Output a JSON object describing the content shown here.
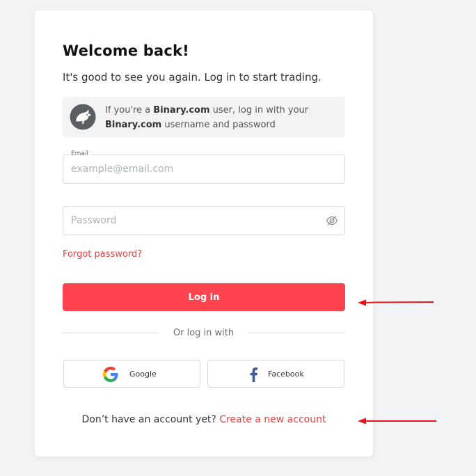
{
  "login": {
    "title": "Welcome back!",
    "subtitle": "It's good to see you again. Log in to start trading.",
    "binary_note": {
      "prefix": "If you're a ",
      "brand1": "Binary.com",
      "middle": " user, log in with your ",
      "brand2": "Binary.com",
      "suffix": " username and password"
    },
    "email": {
      "label": "Email",
      "placeholder": "example@email.com",
      "value": ""
    },
    "password": {
      "placeholder": "Password",
      "value": ""
    },
    "forgot_label": "Forgot password?",
    "login_button": "Log in",
    "divider_text": "Or log in with",
    "social": {
      "google_label": "Google",
      "facebook_label": "Facebook"
    },
    "signup": {
      "prompt": "Don’t have an account yet?",
      "link_label": "Create a new account"
    }
  },
  "colors": {
    "background": "#f2f3f4",
    "brand_red": "#ff444f",
    "link_red": "#ec3f3f",
    "annotation_arrow": "#e8141a"
  },
  "icons": {
    "binary_logo": "bull-logo-icon",
    "password_toggle": "eye-off-icon",
    "google": "google-logo-icon",
    "facebook": "facebook-logo-icon"
  }
}
